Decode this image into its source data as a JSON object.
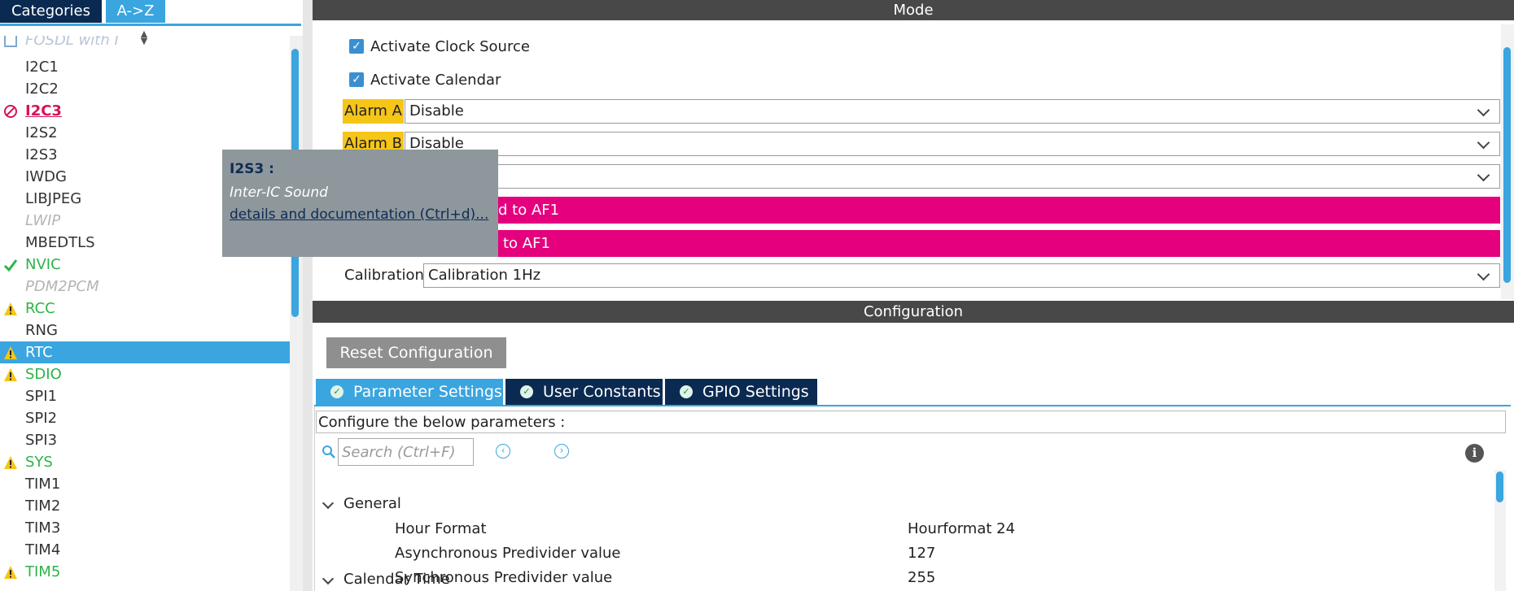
{
  "left_panel": {
    "tabs": {
      "categories": "Categories",
      "az": "A->Z"
    },
    "partial_top_item": "FOSDL with I",
    "items": [
      {
        "label": "I2C1",
        "status": "none"
      },
      {
        "label": "I2C2",
        "status": "none"
      },
      {
        "label": "I2C3",
        "status": "error"
      },
      {
        "label": "I2S2",
        "status": "none"
      },
      {
        "label": "I2S3",
        "status": "none"
      },
      {
        "label": "IWDG",
        "status": "none"
      },
      {
        "label": "LIBJPEG",
        "status": "none"
      },
      {
        "label": "LWIP",
        "status": "disabled"
      },
      {
        "label": "MBEDTLS",
        "status": "none"
      },
      {
        "label": "NVIC",
        "status": "ok"
      },
      {
        "label": "PDM2PCM",
        "status": "disabled"
      },
      {
        "label": "RCC",
        "status": "warning"
      },
      {
        "label": "RNG",
        "status": "none"
      },
      {
        "label": "RTC",
        "status": "warning-selected"
      },
      {
        "label": "SDIO",
        "status": "warning"
      },
      {
        "label": "SPI1",
        "status": "none"
      },
      {
        "label": "SPI2",
        "status": "none"
      },
      {
        "label": "SPI3",
        "status": "none"
      },
      {
        "label": "SYS",
        "status": "warning"
      },
      {
        "label": "TIM1",
        "status": "none"
      },
      {
        "label": "TIM2",
        "status": "none"
      },
      {
        "label": "TIM3",
        "status": "none"
      },
      {
        "label": "TIM4",
        "status": "none"
      },
      {
        "label": "TIM5",
        "status": "warning"
      }
    ]
  },
  "tooltip": {
    "title": "I2S3 :",
    "description": "Inter-IC Sound",
    "link": "details and documentation (Ctrl+d)..."
  },
  "mode": {
    "header": "Mode",
    "activate_clock_source": "Activate Clock Source",
    "activate_calendar": "Activate Calendar",
    "alarm_a_label": "Alarm A",
    "alarm_a_value": "Disable",
    "alarm_b_label": "Alarm B",
    "alarm_b_value": "Disable",
    "wakeup_value": "",
    "pink_bar_1_partial": "d to AF1",
    "pink_bar_2_partial": "to AF1",
    "calibration_label": "Calibration",
    "calibration_value": "Calibration 1Hz"
  },
  "configuration": {
    "header": "Configuration",
    "reset_button": "Reset Configuration",
    "tabs": {
      "parameter_settings": "Parameter Settings",
      "user_constants": "User Constants",
      "gpio_settings": "GPIO Settings"
    },
    "configure_label": "Configure the below parameters :",
    "search_placeholder": "Search (Ctrl+F)",
    "groups": {
      "general": "General",
      "calendar_time": "Calendar Time"
    },
    "params": [
      {
        "name": "Hour Format",
        "value": "Hourformat 24"
      },
      {
        "name": "Asynchronous Predivider value",
        "value": "127"
      },
      {
        "name": "Synchronous Predivider value",
        "value": "255"
      }
    ]
  },
  "colors": {
    "accent_blue": "#3aa5df",
    "dark_navy": "#0b2a52",
    "alarm_yellow": "#f5c518",
    "pin_pink": "#e5007e",
    "ok_green": "#2eb34a",
    "error_magenta": "#d4145a"
  }
}
